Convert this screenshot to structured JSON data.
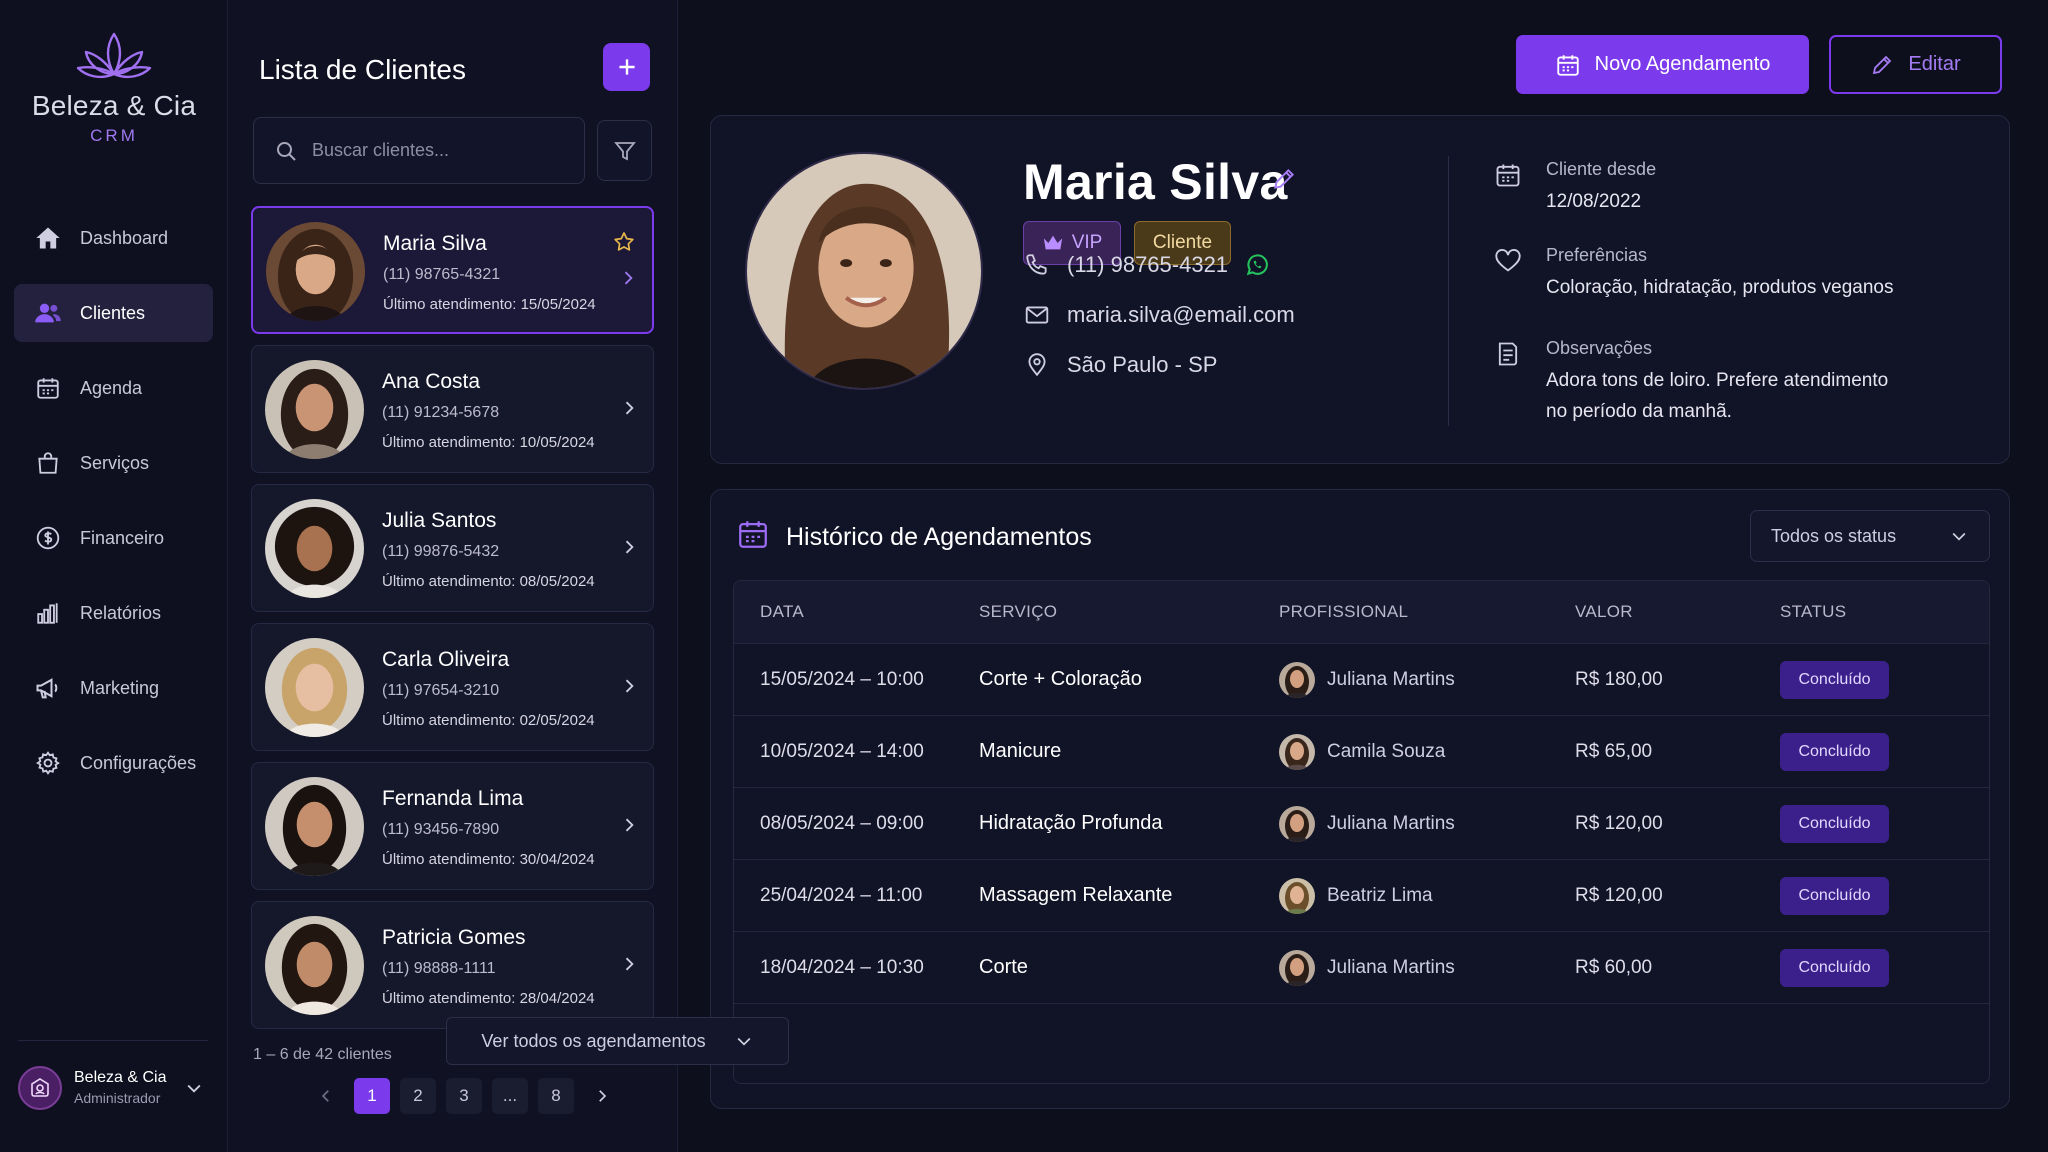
{
  "brand": {
    "name": "Beleza & Cia",
    "sub": "CRM"
  },
  "sidebar": {
    "items": [
      {
        "label": "Dashboard",
        "icon": "home-icon",
        "active": false
      },
      {
        "label": "Clientes",
        "icon": "users-icon",
        "active": true
      },
      {
        "label": "Agenda",
        "icon": "calendar-icon",
        "active": false
      },
      {
        "label": "Serviços",
        "icon": "shopping-bag-icon",
        "active": false
      },
      {
        "label": "Financeiro",
        "icon": "dollar-circle-icon",
        "active": false
      },
      {
        "label": "Relatórios",
        "icon": "bar-chart-icon",
        "active": false
      },
      {
        "label": "Marketing",
        "icon": "megaphone-icon",
        "active": false
      },
      {
        "label": "Configurações",
        "icon": "gear-icon",
        "active": false
      }
    ],
    "user": {
      "name": "Beleza & Cia",
      "role": "Administrador"
    }
  },
  "client_list": {
    "title": "Lista de Clientes",
    "search_placeholder": "Buscar clientes...",
    "clients": [
      {
        "name": "Maria Silva",
        "phone": "(11) 98765-4321",
        "last": "Último atendimento: 15/05/2024",
        "selected": true,
        "starred": true
      },
      {
        "name": "Ana Costa",
        "phone": "(11) 91234-5678",
        "last": "Último atendimento: 10/05/2024",
        "selected": false,
        "starred": false
      },
      {
        "name": "Julia Santos",
        "phone": "(11) 99876-5432",
        "last": "Último atendimento: 08/05/2024",
        "selected": false,
        "starred": false
      },
      {
        "name": "Carla Oliveira",
        "phone": "(11) 97654-3210",
        "last": "Último atendimento: 02/05/2024",
        "selected": false,
        "starred": false
      },
      {
        "name": "Fernanda Lima",
        "phone": "(11) 93456-7890",
        "last": "Último atendimento: 30/04/2024",
        "selected": false,
        "starred": false
      },
      {
        "name": "Patricia Gomes",
        "phone": "(11) 98888-1111",
        "last": "Último atendimento: 28/04/2024",
        "selected": false,
        "starred": false
      }
    ],
    "pagination": {
      "info": "1 – 6 de 42 clientes",
      "pages": [
        "1",
        "2",
        "3",
        "...",
        "8"
      ],
      "current": "1"
    }
  },
  "actions": {
    "new_label": "Novo Agendamento",
    "edit_label": "Editar"
  },
  "profile": {
    "name": "Maria Silva",
    "badges": {
      "vip": "VIP",
      "client": "Cliente"
    },
    "phone": "(11) 98765-4321",
    "email": "maria.silva@email.com",
    "location": "São Paulo - SP",
    "since_label": "Cliente desde",
    "since_value": "12/08/2022",
    "pref_label": "Preferências",
    "pref_value": "Coloração, hidratação, produtos veganos",
    "obs_label": "Observações",
    "obs_line1": "Adora tons de loiro. Prefere atendimento",
    "obs_line2": "no período da manhã."
  },
  "history": {
    "title": "Histórico de Agendamentos",
    "filter": "Todos os status",
    "columns": [
      "DATA",
      "SERVIÇO",
      "PROFISSIONAL",
      "VALOR",
      "STATUS"
    ],
    "rows": [
      {
        "date": "15/05/2024 – 10:00",
        "service": "Corte + Coloração",
        "pro": "Juliana Martins",
        "value": "R$ 180,00",
        "status": "Concluído"
      },
      {
        "date": "10/05/2024 – 14:00",
        "service": "Manicure",
        "pro": "Camila Souza",
        "value": "R$ 65,00",
        "status": "Concluído"
      },
      {
        "date": "08/05/2024 – 09:00",
        "service": "Hidratação Profunda",
        "pro": "Juliana Martins",
        "value": "R$ 120,00",
        "status": "Concluído"
      },
      {
        "date": "25/04/2024 – 11:00",
        "service": "Massagem Relaxante",
        "pro": "Beatriz Lima",
        "value": "R$ 120,00",
        "status": "Concluído"
      },
      {
        "date": "18/04/2024 – 10:30",
        "service": "Corte",
        "pro": "Juliana Martins",
        "value": "R$ 60,00",
        "status": "Concluído"
      }
    ],
    "see_all": "Ver todos os agendamentos"
  },
  "colors": {
    "accent": "#7c3aed",
    "bg": "#0d0f1d",
    "panel": "#111327",
    "vip": "#c6a3ff",
    "client_badge": "#f1d9a0"
  }
}
